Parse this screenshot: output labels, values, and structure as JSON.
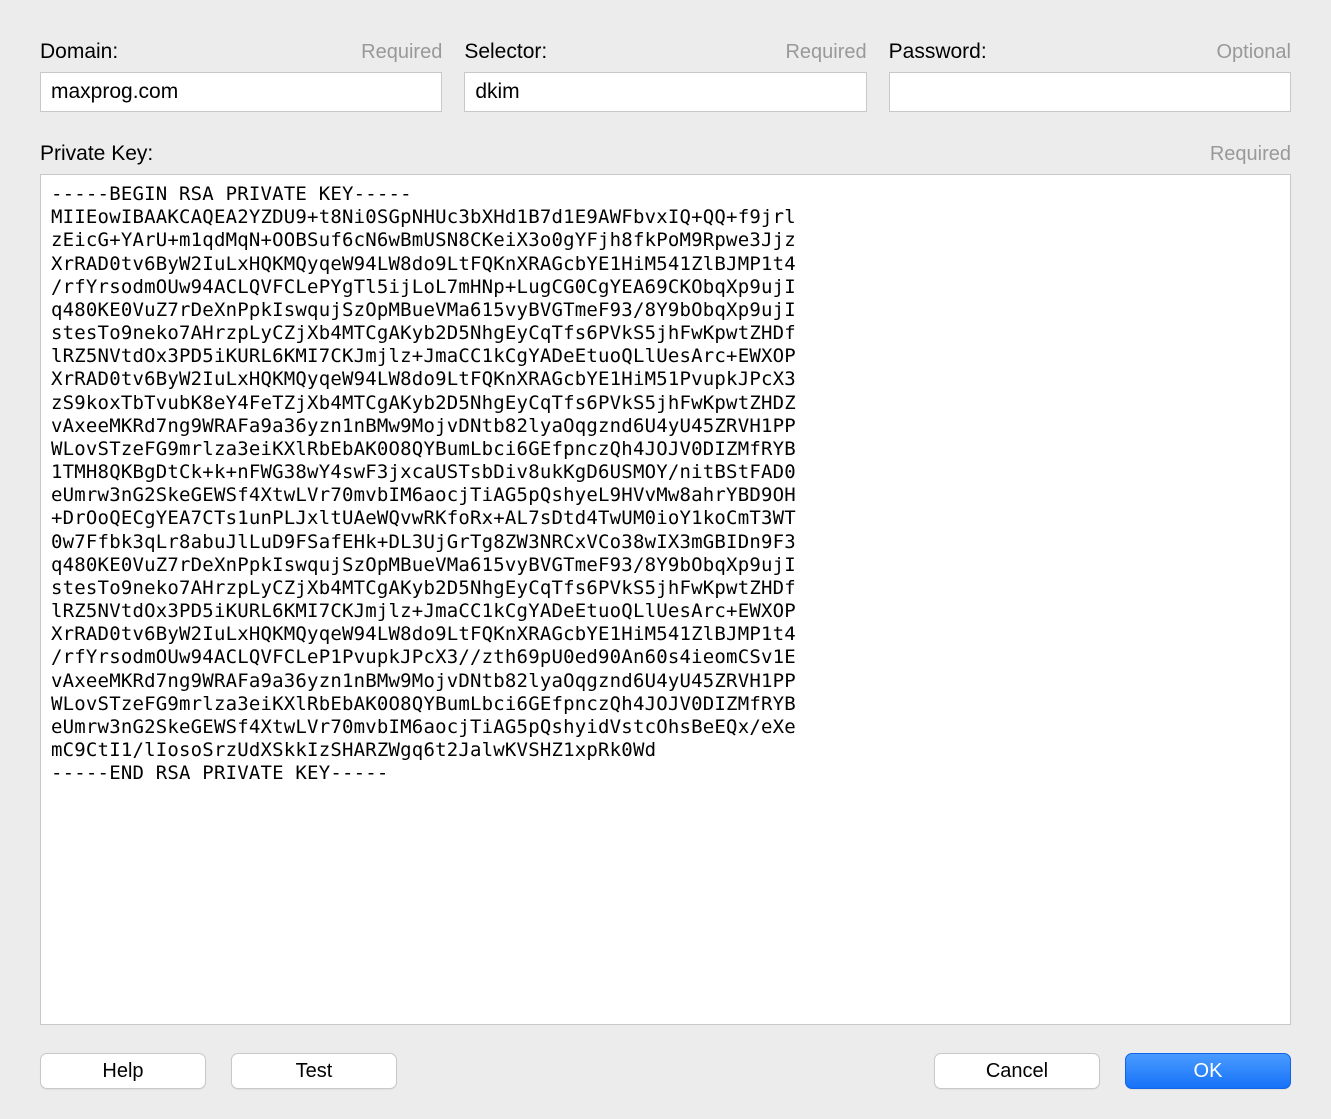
{
  "fields": {
    "domain": {
      "label": "Domain:",
      "hint": "Required",
      "value": "maxprog.com"
    },
    "selector": {
      "label": "Selector:",
      "hint": "Required",
      "value": "dkim"
    },
    "password": {
      "label": "Password:",
      "hint": "Optional",
      "value": ""
    },
    "privateKey": {
      "label": "Private Key:",
      "hint": "Required",
      "value": "-----BEGIN RSA PRIVATE KEY-----\nMIIEowIBAAKCAQEA2YZDU9+t8Ni0SGpNHUc3bXHd1B7d1E9AWFbvxIQ+QQ+f9jrl\nzEicG+YArU+m1qdMqN+OOBSuf6cN6wBmUSN8CKeiX3o0gYFjh8fkPoM9Rpwe3Jjz\nXrRAD0tv6ByW2IuLxHQKMQyqeW94LW8do9LtFQKnXRAGcbYE1HiM541ZlBJMP1t4\n/rfYrsodmOUw94ACLQVFCLePYgTl5ijLoL7mHNp+LugCG0CgYEA69CKObqXp9ujI\nq480KE0VuZ7rDeXnPpkIswqujSzOpMBueVMa615vyBVGTmeF93/8Y9bObqXp9ujI\nstesTo9neko7AHrzpLyCZjXb4MTCgAKyb2D5NhgEyCqTfs6PVkS5jhFwKpwtZHDf\nlRZ5NVtdOx3PD5iKURL6KMI7CKJmjlz+JmaCC1kCgYADeEtuoQLlUesArc+EWXOP\nXrRAD0tv6ByW2IuLxHQKMQyqeW94LW8do9LtFQKnXRAGcbYE1HiM51PvupkJPcX3\nzS9koxTbTvubK8eY4FeTZjXb4MTCgAKyb2D5NhgEyCqTfs6PVkS5jhFwKpwtZHDZ\nvAxeeMKRd7ng9WRAFa9a36yzn1nBMw9MojvDNtb82lyaOqgznd6U4yU45ZRVH1PP\nWLovSTzeFG9mrlza3eiKXlRbEbAK0O8QYBumLbci6GEfpnczQh4JOJV0DIZMfRYB\n1TMH8QKBgDtCk+k+nFWG38wY4swF3jxcaUSTsbDiv8ukKgD6USMOY/nitBStFAD0\neUmrw3nG2SkeGEWSf4XtwLVr70mvbIM6aocjTiAG5pQshyeL9HVvMw8ahrYBD9OH\n+DrOoQECgYEA7CTs1unPLJxltUAeWQvwRKfoRx+AL7sDtd4TwUM0ioY1koCmT3WT\n0w7Ffbk3qLr8abuJlLuD9FSafEHk+DL3UjGrTg8ZW3NRCxVCo38wIX3mGBIDn9F3\nq480KE0VuZ7rDeXnPpkIswqujSzOpMBueVMa615vyBVGTmeF93/8Y9bObqXp9ujI\nstesTo9neko7AHrzpLyCZjXb4MTCgAKyb2D5NhgEyCqTfs6PVkS5jhFwKpwtZHDf\nlRZ5NVtdOx3PD5iKURL6KMI7CKJmjlz+JmaCC1kCgYADeEtuoQLlUesArc+EWXOP\nXrRAD0tv6ByW2IuLxHQKMQyqeW94LW8do9LtFQKnXRAGcbYE1HiM541ZlBJMP1t4\n/rfYrsodmOUw94ACLQVFCLeP1PvupkJPcX3//zth69pU0ed90An60s4ieomCSv1E\nvAxeeMKRd7ng9WRAFa9a36yzn1nBMw9MojvDNtb82lyaOqgznd6U4yU45ZRVH1PP\nWLovSTzeFG9mrlza3eiKXlRbEbAK0O8QYBumLbci6GEfpnczQh4JOJV0DIZMfRYB\neUmrw3nG2SkeGEWSf4XtwLVr70mvbIM6aocjTiAG5pQshyidVstcOhsBeEQx/eXe\nmC9CtI1/lIosoSrzUdXSkkIzSHARZWgq6t2JalwKVSHZ1xpRk0Wd\n-----END RSA PRIVATE KEY-----"
    }
  },
  "buttons": {
    "help": "Help",
    "test": "Test",
    "cancel": "Cancel",
    "ok": "OK"
  }
}
